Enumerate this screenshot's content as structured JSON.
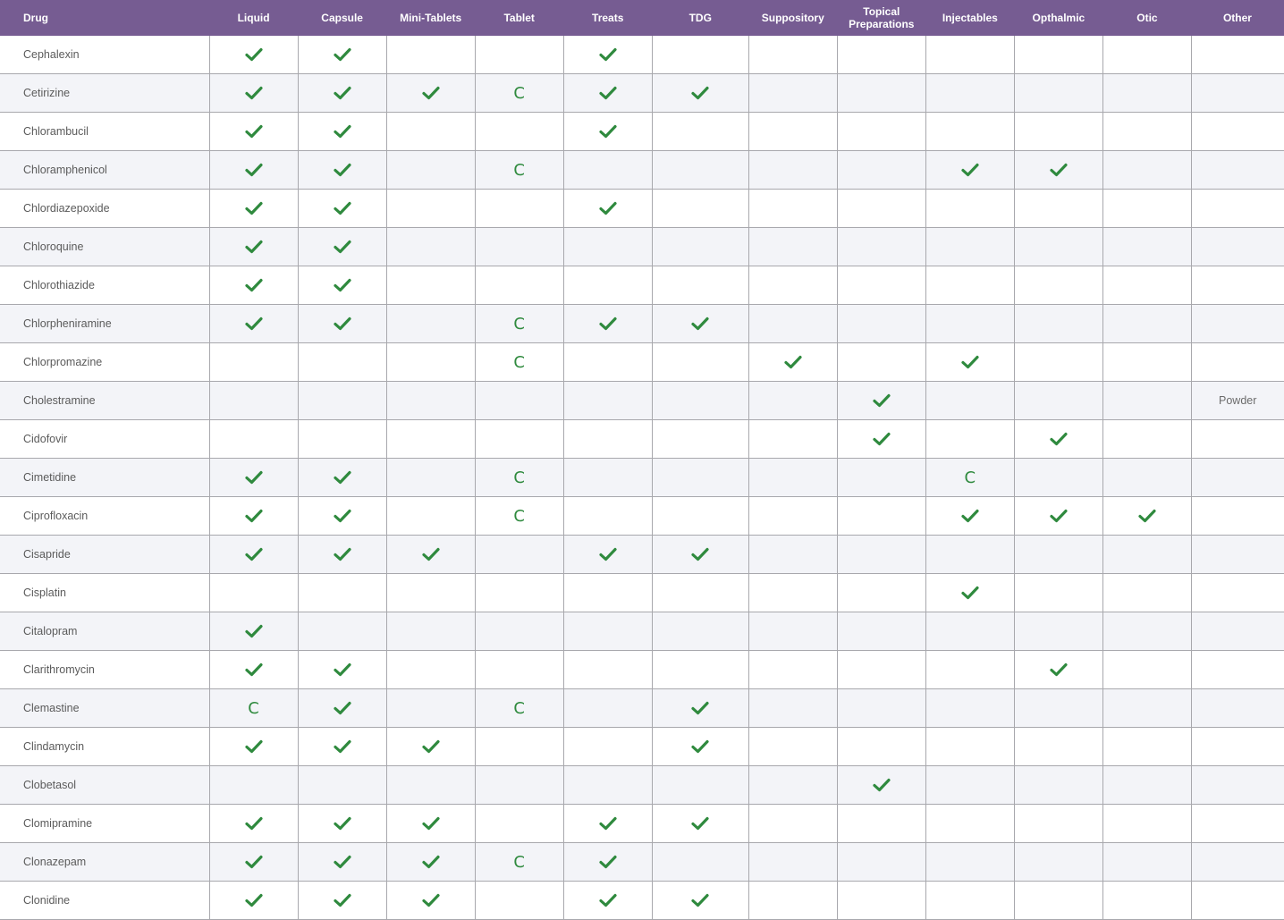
{
  "colors": {
    "header_bg": "#765c92",
    "check": "#2f8a3e",
    "row_alt": "#f3f4f8",
    "grid": "#a8a8ad"
  },
  "icons": {
    "check": "check-icon"
  },
  "headers": [
    "Drug",
    "Liquid",
    "Capsule",
    "Mini-Tablets",
    "Tablet",
    "Treats",
    "TDG",
    "Suppository",
    "Topical\nPreparations",
    "Injectables",
    "Opthalmic",
    "Otic",
    "Other"
  ],
  "rows": [
    {
      "drug": "Cephalexin",
      "cells": [
        "✓",
        "✓",
        "",
        "",
        "✓",
        "",
        "",
        "",
        "",
        "",
        "",
        ""
      ]
    },
    {
      "drug": "Cetirizine",
      "cells": [
        "✓",
        "✓",
        "✓",
        "C",
        "✓",
        "✓",
        "",
        "",
        "",
        "",
        "",
        ""
      ]
    },
    {
      "drug": "Chlorambucil",
      "cells": [
        "✓",
        "✓",
        "",
        "",
        "✓",
        "",
        "",
        "",
        "",
        "",
        "",
        ""
      ]
    },
    {
      "drug": "Chloramphenicol",
      "cells": [
        "✓",
        "✓",
        "",
        "C",
        "",
        "",
        "",
        "",
        "✓",
        "✓",
        "",
        ""
      ]
    },
    {
      "drug": "Chlordiazepoxide",
      "cells": [
        "✓",
        "✓",
        "",
        "",
        "✓",
        "",
        "",
        "",
        "",
        "",
        "",
        ""
      ]
    },
    {
      "drug": "Chloroquine",
      "cells": [
        "✓",
        "✓",
        "",
        "",
        "",
        "",
        "",
        "",
        "",
        "",
        "",
        ""
      ]
    },
    {
      "drug": "Chlorothiazide",
      "cells": [
        "✓",
        "✓",
        "",
        "",
        "",
        "",
        "",
        "",
        "",
        "",
        "",
        ""
      ]
    },
    {
      "drug": "Chlorpheniramine",
      "cells": [
        "✓",
        "✓",
        "",
        "C",
        "✓",
        "✓",
        "",
        "",
        "",
        "",
        "",
        ""
      ]
    },
    {
      "drug": "Chlorpromazine",
      "cells": [
        "",
        "",
        "",
        "C",
        "",
        "",
        "✓",
        "",
        "✓",
        "",
        "",
        ""
      ]
    },
    {
      "drug": "Cholestramine",
      "cells": [
        "",
        "",
        "",
        "",
        "",
        "",
        "",
        "✓",
        "",
        "",
        "",
        "Powder"
      ]
    },
    {
      "drug": "Cidofovir",
      "cells": [
        "",
        "",
        "",
        "",
        "",
        "",
        "",
        "✓",
        "",
        "✓",
        "",
        ""
      ]
    },
    {
      "drug": "Cimetidine",
      "cells": [
        "✓",
        "✓",
        "",
        "C",
        "",
        "",
        "",
        "",
        "C",
        "",
        "",
        ""
      ]
    },
    {
      "drug": "Ciprofloxacin",
      "cells": [
        "✓",
        "✓",
        "",
        "C",
        "",
        "",
        "",
        "",
        "✓",
        "✓",
        "✓",
        ""
      ]
    },
    {
      "drug": "Cisapride",
      "cells": [
        "✓",
        "✓",
        "✓",
        "",
        "✓",
        "✓",
        "",
        "",
        "",
        "",
        "",
        ""
      ]
    },
    {
      "drug": "Cisplatin",
      "cells": [
        "",
        "",
        "",
        "",
        "",
        "",
        "",
        "",
        "✓",
        "",
        "",
        ""
      ]
    },
    {
      "drug": "Citalopram",
      "cells": [
        "✓",
        "",
        "",
        "",
        "",
        "",
        "",
        "",
        "",
        "",
        "",
        ""
      ]
    },
    {
      "drug": "Clarithromycin",
      "cells": [
        "✓",
        "✓",
        "",
        "",
        "",
        "",
        "",
        "",
        "",
        "✓",
        "",
        ""
      ]
    },
    {
      "drug": "Clemastine",
      "cells": [
        "C",
        "✓",
        "",
        "C",
        "",
        "✓",
        "",
        "",
        "",
        "",
        "",
        ""
      ]
    },
    {
      "drug": "Clindamycin",
      "cells": [
        "✓",
        "✓",
        "✓",
        "",
        "",
        "✓",
        "",
        "",
        "",
        "",
        "",
        ""
      ]
    },
    {
      "drug": "Clobetasol",
      "cells": [
        "",
        "",
        "",
        "",
        "",
        "",
        "",
        "✓",
        "",
        "",
        "",
        ""
      ]
    },
    {
      "drug": "Clomipramine",
      "cells": [
        "✓",
        "✓",
        "✓",
        "",
        "✓",
        "✓",
        "",
        "",
        "",
        "",
        "",
        ""
      ]
    },
    {
      "drug": "Clonazepam",
      "cells": [
        "✓",
        "✓",
        "✓",
        "C",
        "✓",
        "",
        "",
        "",
        "",
        "",
        "",
        ""
      ]
    },
    {
      "drug": "Clonidine",
      "cells": [
        "✓",
        "✓",
        "✓",
        "",
        "✓",
        "✓",
        "",
        "",
        "",
        "",
        "",
        ""
      ]
    }
  ]
}
